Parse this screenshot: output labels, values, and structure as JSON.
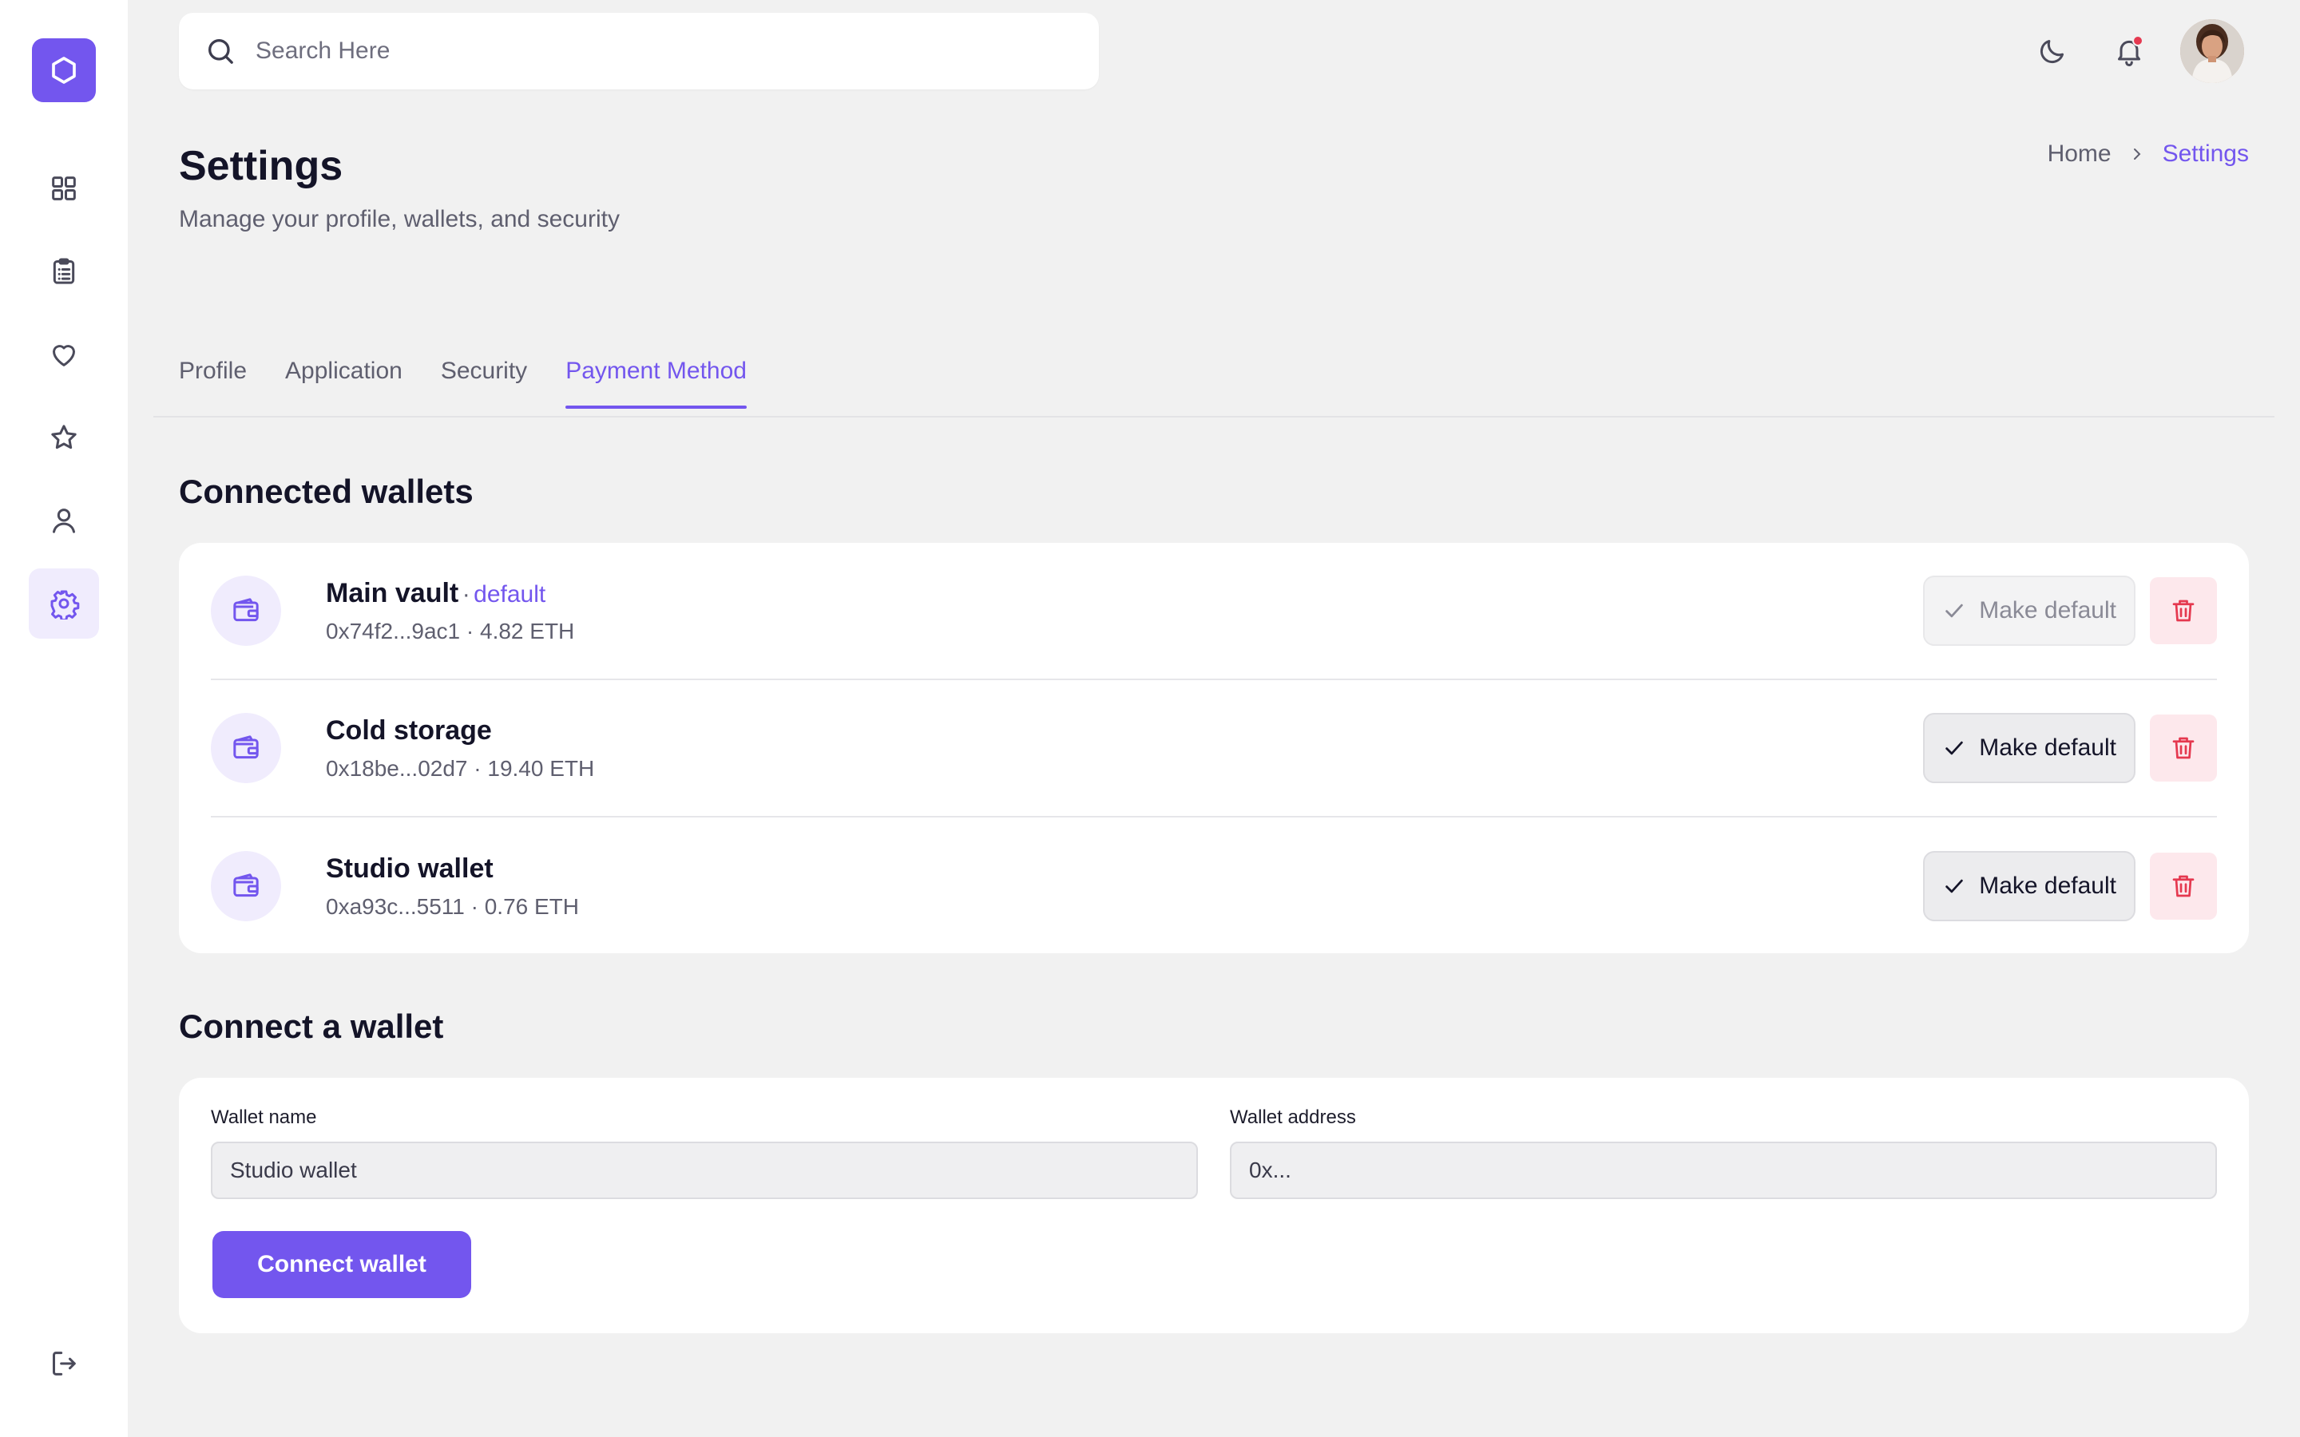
{
  "search": {
    "placeholder": "Search Here"
  },
  "header": {
    "title": "Settings",
    "subtitle": "Manage your profile, wallets, and security",
    "breadcrumb": {
      "home": "Home",
      "current": "Settings"
    }
  },
  "tabs": [
    {
      "label": "Profile",
      "active": false
    },
    {
      "label": "Application",
      "active": false
    },
    {
      "label": "Security",
      "active": false
    },
    {
      "label": "Payment Method",
      "active": true
    }
  ],
  "connected": {
    "title": "Connected wallets",
    "wallets": [
      {
        "name": "Main vault",
        "separator": "·",
        "badge": "default",
        "meta": "0x74f2...9ac1 · 4.82 ETH",
        "action_label": "Make default",
        "is_default": true
      },
      {
        "name": "Cold storage",
        "separator": "",
        "badge": "",
        "meta": "0x18be...02d7 · 19.40 ETH",
        "action_label": "Make default",
        "is_default": false
      },
      {
        "name": "Studio wallet",
        "separator": "",
        "badge": "",
        "meta": "0xa93c...5511 · 0.76 ETH",
        "action_label": "Make default",
        "is_default": false
      }
    ]
  },
  "connect": {
    "title": "Connect a wallet",
    "name_label": "Wallet name",
    "name_placeholder": "Studio wallet",
    "address_label": "Wallet address",
    "address_placeholder": "0x...",
    "submit_label": "Connect wallet"
  },
  "colors": {
    "accent": "#7356ee",
    "accent_soft": "#f0ecfd",
    "danger": "#e5384f",
    "danger_soft": "#fde8ec",
    "background": "#f1f1f1"
  },
  "icons": {
    "sidebar": [
      "logo-hexagon-icon",
      "dashboard-grid-icon",
      "clipboard-icon",
      "heart-icon",
      "star-icon",
      "user-icon",
      "settings-gear-icon",
      "logout-icon"
    ],
    "topbar": [
      "search-icon",
      "moon-icon",
      "bell-icon"
    ],
    "rows": [
      "wallet-icon",
      "check-icon",
      "trash-icon"
    ]
  }
}
